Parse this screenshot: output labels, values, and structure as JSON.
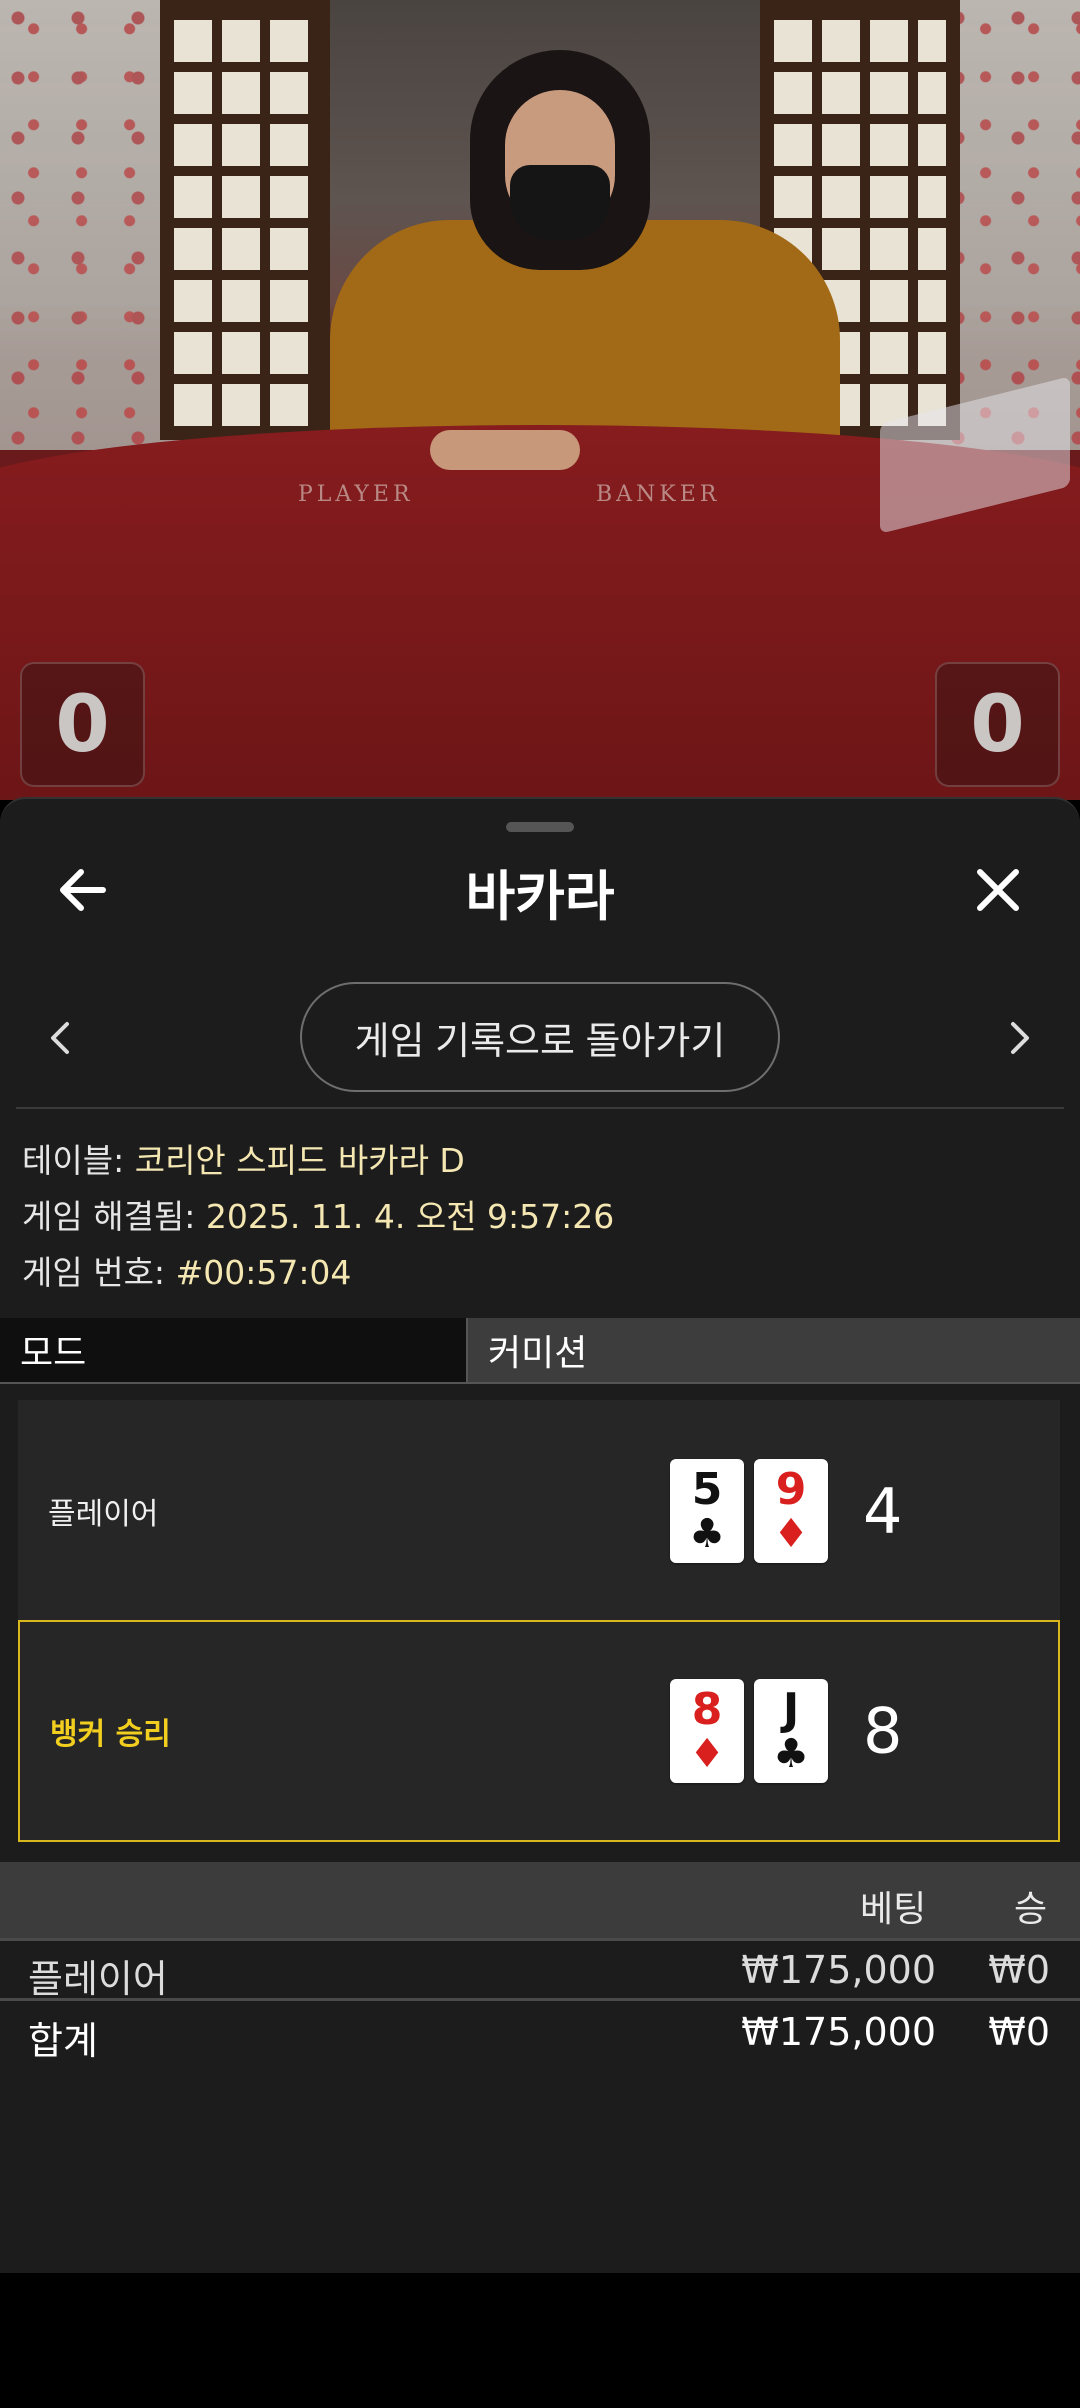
{
  "video": {
    "table_labels": {
      "player": "PLAYER",
      "banker": "BANKER"
    },
    "player_score": "0",
    "banker_score": "0"
  },
  "header": {
    "title": "바카라",
    "back_icon": "arrow-left-icon",
    "close_icon": "close-icon"
  },
  "history_nav": {
    "button_label": "게임 기록으로 돌아가기",
    "prev_icon": "chevron-left-icon",
    "next_icon": "chevron-right-icon"
  },
  "game_info": {
    "table_label": "테이블:",
    "table_value": "코리안 스피드 바카라 D",
    "resolved_label": "게임 해결됨:",
    "resolved_value": "2025. 11. 4. 오전 9:57:26",
    "number_label": "게임 번호:",
    "number_value": "#00:57:04"
  },
  "mode_tabs": {
    "mode": "모드",
    "commission": "커미션"
  },
  "results": [
    {
      "label": "플레이어",
      "winner": false,
      "cards": [
        {
          "rank": "5",
          "suit": "♣",
          "color": "black"
        },
        {
          "rank": "9",
          "suit": "♦",
          "color": "red"
        }
      ],
      "score": "4"
    },
    {
      "label": "뱅커 승리",
      "winner": true,
      "cards": [
        {
          "rank": "8",
          "suit": "♦",
          "color": "red"
        },
        {
          "rank": "J",
          "suit": "♣",
          "color": "black"
        }
      ],
      "score": "8"
    }
  ],
  "bets": {
    "columns": {
      "bet": "베팅",
      "win": "승"
    },
    "rows": [
      {
        "name": "플레이어",
        "bet": "₩175,000",
        "win": "₩0"
      }
    ],
    "total": {
      "name": "합계",
      "bet": "₩175,000",
      "win": "₩0"
    }
  },
  "colors": {
    "accent_gold": "#d9b81e",
    "info_value": "#f4e7b2",
    "sheet_bg": "#1c1c1c"
  }
}
